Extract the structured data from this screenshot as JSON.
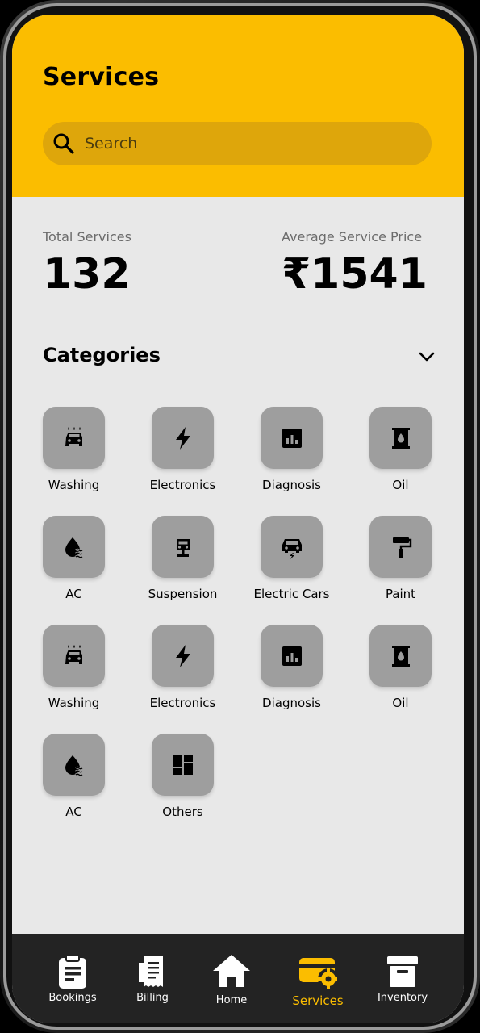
{
  "header": {
    "title": "Services",
    "search_placeholder": "Search"
  },
  "stats": {
    "total_label": "Total Services",
    "total_value": "132",
    "avg_label": "Average Service Price",
    "avg_value": "₹1541"
  },
  "categories": {
    "title": "Categories",
    "items": [
      {
        "label": "Washing",
        "icon": "car-wash-icon"
      },
      {
        "label": "Electronics",
        "icon": "lightning-icon"
      },
      {
        "label": "Diagnosis",
        "icon": "chart-icon"
      },
      {
        "label": "Oil",
        "icon": "oil-barrel-icon"
      },
      {
        "label": "AC",
        "icon": "water-drop-icon"
      },
      {
        "label": "Suspension",
        "icon": "suspension-icon"
      },
      {
        "label": "Electric Cars",
        "icon": "electric-car-icon"
      },
      {
        "label": "Paint",
        "icon": "paint-roller-icon"
      },
      {
        "label": "Washing",
        "icon": "car-wash-icon"
      },
      {
        "label": "Electronics",
        "icon": "lightning-icon"
      },
      {
        "label": "Diagnosis",
        "icon": "chart-icon"
      },
      {
        "label": "Oil",
        "icon": "oil-barrel-icon"
      },
      {
        "label": "AC",
        "icon": "water-drop-icon"
      },
      {
        "label": "Others",
        "icon": "grid-icon"
      }
    ]
  },
  "nav": {
    "active_color": "#fbbd00",
    "items": [
      {
        "label": "Bookings",
        "icon": "clipboard-icon"
      },
      {
        "label": "Billing",
        "icon": "receipt-icon"
      },
      {
        "label": "Home",
        "icon": "home-icon"
      },
      {
        "label": "Services",
        "icon": "services-gear-icon",
        "active": true
      },
      {
        "label": "Inventory",
        "icon": "archive-box-icon"
      }
    ]
  },
  "colors": {
    "accent": "#fbbd00",
    "search_bg": "#dea60b",
    "background": "#e8e8e8",
    "tile": "#9e9e9e",
    "nav_bg": "#232323"
  }
}
